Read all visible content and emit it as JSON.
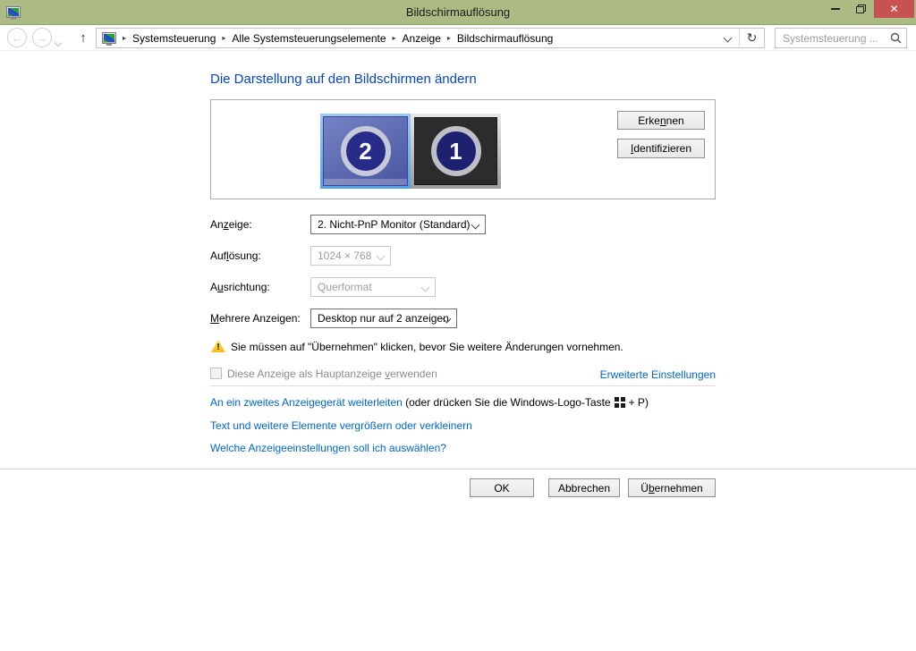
{
  "window": {
    "title": "Bildschirmauflösung"
  },
  "toolbar": {
    "back_icon": "←",
    "forward_icon": "→",
    "up_icon": "↑",
    "refresh_icon": "↻",
    "breadcrumb_separator": "▸",
    "breadcrumb": {
      "items": [
        "Systemsteuerung",
        "Alle Systemsteuerungselemente",
        "Anzeige",
        "Bildschirmauflösung"
      ]
    },
    "search": {
      "placeholder": "Systemsteuerung ..."
    }
  },
  "page": {
    "heading": "Die Darstellung auf den Bildschirmen ändern"
  },
  "preview": {
    "monitor2_label": "2",
    "monitor1_label": "1",
    "detect": {
      "pre": "Erke",
      "key": "n",
      "post": "nen"
    },
    "identify": {
      "pre": "",
      "key": "I",
      "post": "dentifizieren"
    }
  },
  "settings": {
    "display": {
      "label": {
        "pre": "An",
        "key": "z",
        "post": "eige:"
      },
      "value": "2. Nicht-PnP Monitor (Standard)"
    },
    "resolution": {
      "label": {
        "pre": "Auf",
        "key": "l",
        "post": "ösung:"
      },
      "value": "1024 × 768"
    },
    "orientation": {
      "label": {
        "pre": "A",
        "key": "u",
        "post": "srichtung:"
      },
      "value": "Querformat"
    },
    "multiple_displays": {
      "label": {
        "pre": "",
        "key": "M",
        "post": "ehrere Anzeigen:"
      },
      "value": "Desktop nur auf 2 anzeigen"
    }
  },
  "warning": {
    "icon_glyph": "!",
    "text": "Sie müssen auf \"Übernehmen\" klicken, bevor Sie weitere Änderungen vornehmen."
  },
  "main_display_checkbox": {
    "label": {
      "pre": "Diese Anzeige als Hauptanzeige ",
      "key": "v",
      "post": "erwenden"
    }
  },
  "links": {
    "advanced": "Erweiterte Einstellungen",
    "project": "An ein zweites Anzeigegerät weiterleiten",
    "project_suffix_pre": "(oder drücken Sie die Windows-Logo-Taste",
    "project_suffix_post": "+ P)",
    "resize": "Text und weitere Elemente vergrößern oder verkleinern",
    "help": "Welche Anzeigeeinstellungen soll ich auswählen?"
  },
  "footer": {
    "ok": "OK",
    "cancel": "Abbrechen",
    "apply": {
      "pre": "Ü",
      "key": "b",
      "post": "ernehmen"
    }
  },
  "colors": {
    "titlebar": "#abbb83",
    "close_button": "#c85252",
    "heading_blue": "#0546c6",
    "link_blue": "#0066cc",
    "selection_highlight": "#54a1e2"
  }
}
